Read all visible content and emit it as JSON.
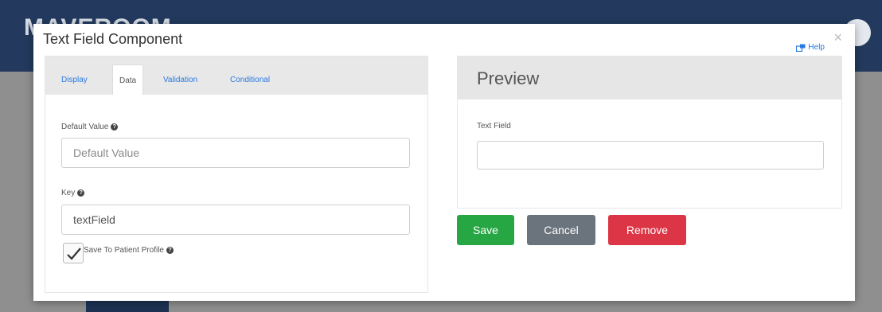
{
  "background": {
    "brand_text": "MAVEROOM"
  },
  "modal": {
    "title": "Text Field Component",
    "help_label": "Help",
    "close_label": "×"
  },
  "tabs": [
    {
      "label": "Display",
      "active": false
    },
    {
      "label": "Data",
      "active": true
    },
    {
      "label": "Validation",
      "active": false
    },
    {
      "label": "Conditional",
      "active": false
    }
  ],
  "form": {
    "default_value": {
      "label": "Default Value",
      "placeholder": "Default Value",
      "value": ""
    },
    "key": {
      "label": "Key",
      "value": "textField"
    },
    "save_to_profile": {
      "label": "Save To Patient Profile",
      "checked": true
    }
  },
  "preview": {
    "title": "Preview",
    "field_label": "Text Field",
    "field_value": ""
  },
  "buttons": {
    "save": "Save",
    "cancel": "Cancel",
    "remove": "Remove"
  },
  "colors": {
    "link": "#2a7ae2",
    "save": "#27a744",
    "cancel": "#6b737c",
    "remove": "#dc3545",
    "header": "#233a5e"
  }
}
